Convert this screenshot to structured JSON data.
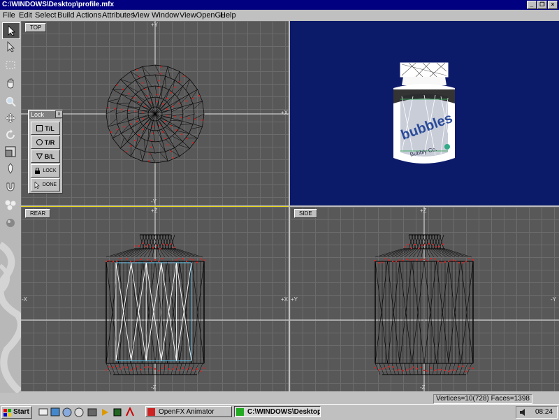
{
  "window": {
    "title": "C:\\WINDOWS\\Desktop\\profile.mfx"
  },
  "menu": [
    "File",
    "Edit",
    "Select",
    "Build",
    "Actions",
    "Attributes",
    "View",
    "Window",
    "ViewOpenGL",
    "Help"
  ],
  "viewports": {
    "top": "TOP",
    "rear": "REAR",
    "side": "SIDE"
  },
  "axes": {
    "top": {
      "north": "+Y",
      "south": "-Y",
      "east": "+X"
    },
    "rear": {
      "north": "+Z",
      "south": "-Z",
      "west": "-X",
      "east": "+X"
    },
    "side": {
      "north": "+Z",
      "south": "-Z",
      "west": "+Y",
      "east": "-Y"
    }
  },
  "lock_panel": {
    "title": "Lock",
    "close": "x",
    "buttons": [
      "T/L",
      "T/R",
      "B/L",
      "LOCK",
      "DONE"
    ]
  },
  "persp_label": {
    "brand": "bubbles",
    "small": "Bubbly Co."
  },
  "status": {
    "text": "Vertices=10(728) Faces=1398"
  },
  "taskbar": {
    "start": "Start",
    "tasks": [
      "OpenFX Animator",
      "C:\\WINDOWS\\Desktop\\p..."
    ],
    "clock": "08:24"
  },
  "colors": {
    "title_bg": "#000080",
    "viewport_bg": "#585858",
    "persp_bg": "#0c1a6a",
    "wire": "#000000",
    "vertex": "#e02020",
    "highlight": "#e8d820"
  }
}
